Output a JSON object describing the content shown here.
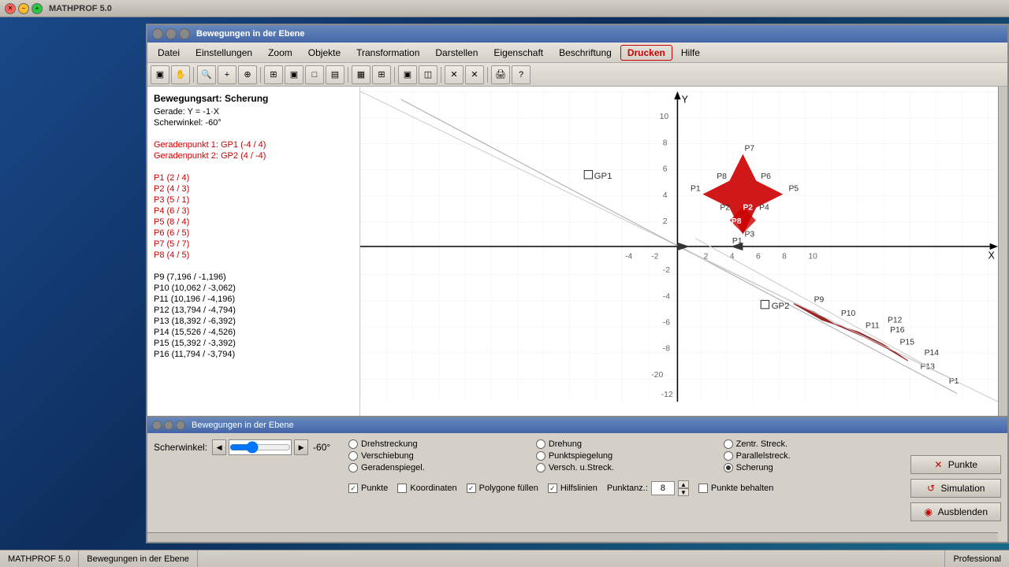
{
  "app": {
    "title": "MATHPROF 5.0",
    "inner_title": "Bewegungen in der Ebene"
  },
  "menu": {
    "items": [
      "Datei",
      "Einstellungen",
      "Zoom",
      "Objekte",
      "Transformation",
      "Darstellen",
      "Eigenschaft",
      "Beschriftung",
      "Drucken",
      "Hilfe"
    ],
    "active": "Drucken"
  },
  "info": {
    "bewegungsart": "Bewegungsart: Scherung",
    "gerade": "Gerade: Y = -1·X",
    "scherwinkel": "Scherwinkel: -60°",
    "geradenpunkt1": "Geradenpunkt 1: GP1 (-4 / 4)",
    "geradenpunkt2": "Geradenpunkt 2: GP2 (4 / -4)",
    "points": [
      "P1 (2 / 4)",
      "P2 (4 / 3)",
      "P3 (5 / 1)",
      "P4 (6 / 3)",
      "P5 (8 / 4)",
      "P6 (6 / 5)",
      "P7 (5 / 7)",
      "P8 (4 / 5)",
      "P9 (7,196 / -1,196)",
      "P10 (10,062 / -3,062)",
      "P11 (10,196 / -4,196)",
      "P12 (13,794 / -4,794)",
      "P13 (18,392 / -6,392)",
      "P14 (15,526 / -4,526)",
      "P15 (15,392 / -3,392)",
      "P16 (11,794 / -3,794)"
    ]
  },
  "control_panel": {
    "title": "Bewegungen in der Ebene",
    "scherwinkel_label": "Scherwinkel:",
    "scherwinkel_value": "-60°",
    "radio_options": [
      {
        "label": "Drehstreckung",
        "selected": false
      },
      {
        "label": "Drehung",
        "selected": false
      },
      {
        "label": "Zentr. Streck.",
        "selected": false
      },
      {
        "label": "Verschiebung",
        "selected": false
      },
      {
        "label": "Punktspiegelung",
        "selected": false
      },
      {
        "label": "Parallelstreck.",
        "selected": false
      },
      {
        "label": "Geradenspiegel.",
        "selected": false
      },
      {
        "label": "Versch. u.Streck.",
        "selected": false
      },
      {
        "label": "Scherung",
        "selected": true
      }
    ],
    "checkboxes": [
      {
        "label": "Punkte",
        "checked": true
      },
      {
        "label": "Koordinaten",
        "checked": false
      },
      {
        "label": "Polygone füllen",
        "checked": true
      },
      {
        "label": "Hilfslinien",
        "checked": true
      },
      {
        "label": "Punkte behalten",
        "checked": false
      }
    ],
    "punktanz_label": "Punktanz.:",
    "punktanz_value": "8",
    "buttons": [
      {
        "label": "Punkte",
        "icon": "✕"
      },
      {
        "label": "Simulation",
        "icon": "↺"
      },
      {
        "label": "Ausblenden",
        "icon": "◉"
      }
    ]
  },
  "status": {
    "app_name": "MATHPROF 5.0",
    "window_name": "Bewegungen in der Ebene",
    "edition": "Professional"
  }
}
